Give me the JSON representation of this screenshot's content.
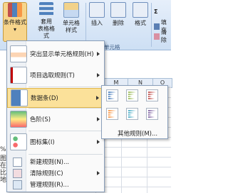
{
  "ribbon": {
    "buttons": [
      {
        "line1": "条件格式",
        "active": true
      },
      {
        "line1": "套用",
        "line2": "表格格式"
      },
      {
        "line1": "单元格",
        "line2": "样式"
      },
      {
        "line1": "插入"
      },
      {
        "line1": "删除"
      },
      {
        "line1": "格式"
      }
    ],
    "right_cmds": [
      "Σ",
      "填充",
      "清除"
    ],
    "group_label": "单元格"
  },
  "sheet": {
    "col_headers": [
      "M",
      "N",
      "O"
    ],
    "side_text": [
      "%)",
      "图",
      "在",
      "比",
      "地"
    ]
  },
  "menu": {
    "items": [
      {
        "label": "突出显示单元格规则(H)"
      },
      {
        "label": "项目选取规则(T)"
      },
      {
        "label": "数据条(D)",
        "highlighted": true
      },
      {
        "label": "色阶(S)"
      },
      {
        "label": "图标集(I)"
      }
    ],
    "small_items": [
      {
        "label": "新建规则(N)..."
      },
      {
        "label": "清除规则(C)"
      },
      {
        "label": "管理规则(R)..."
      }
    ]
  },
  "submenu": {
    "colors": [
      "#4f81bd",
      "#9bbb59",
      "#c0504d",
      "#f79646",
      "#4bacc6",
      "#8064a2"
    ],
    "other_rules": "其他规则(M)..."
  }
}
